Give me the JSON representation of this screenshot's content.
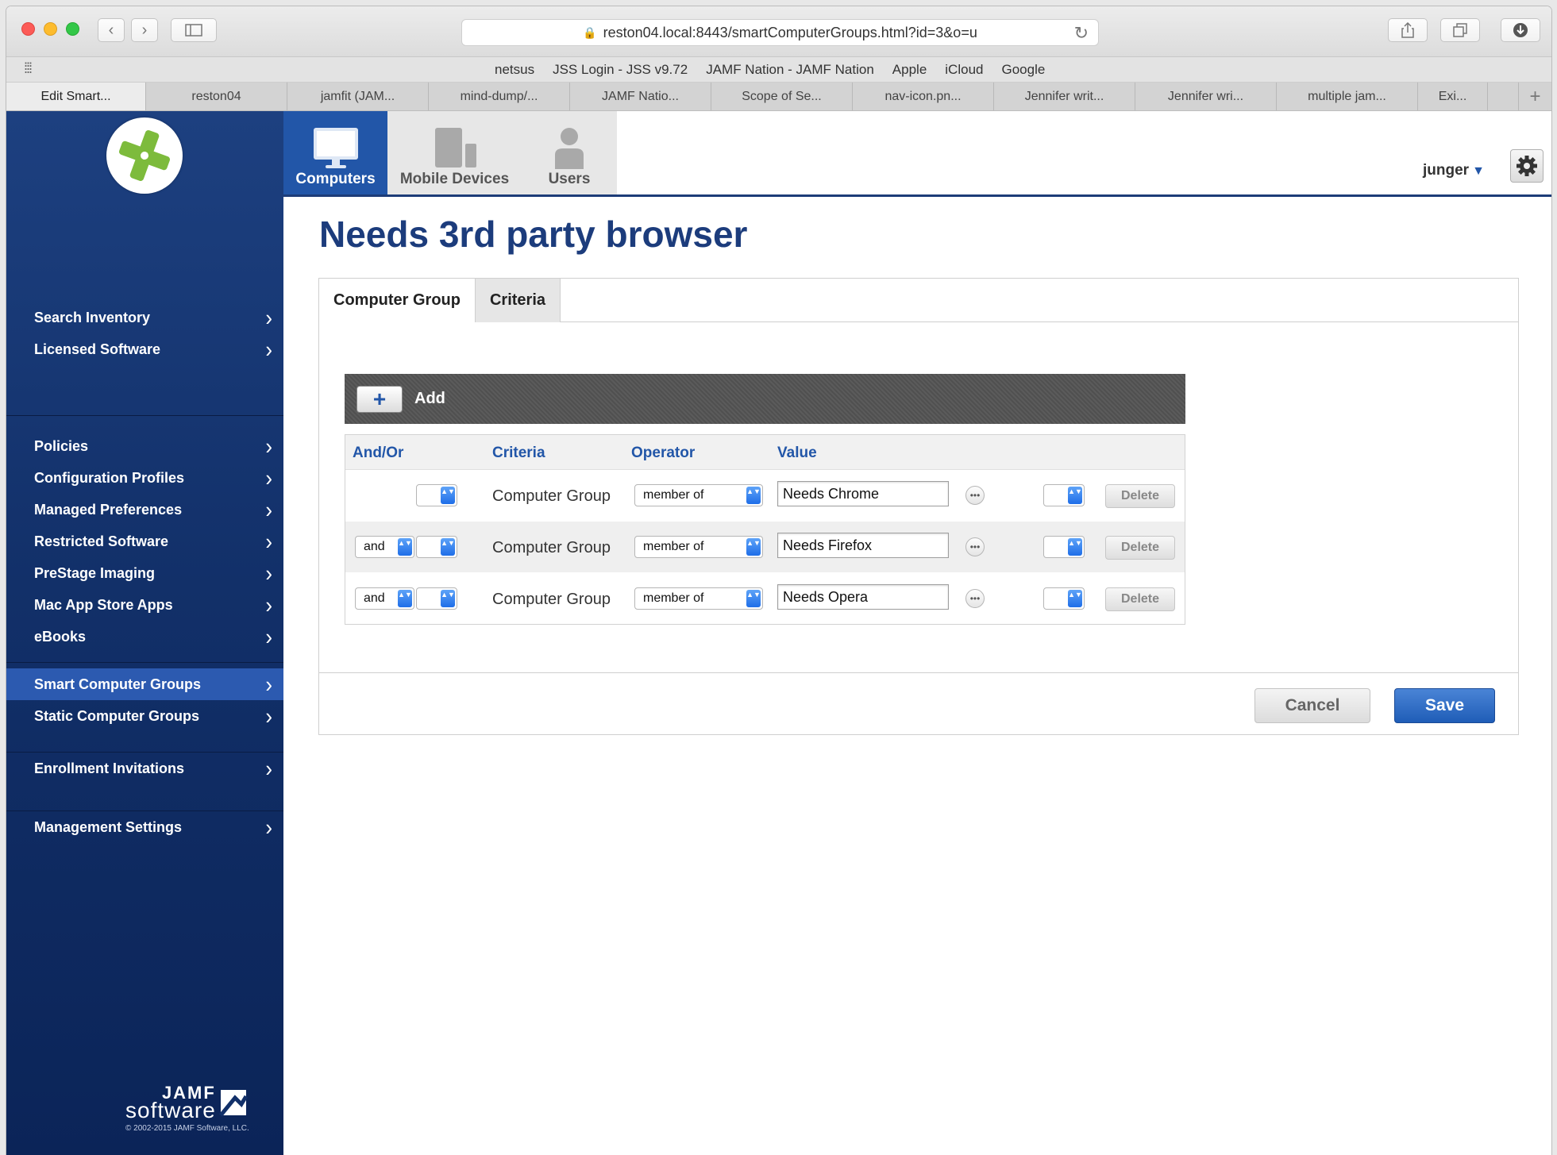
{
  "browser": {
    "url": "reston04.local:8443/smartComputerGroups.html?id=3&o=u",
    "favorites": [
      "netsus",
      "JSS Login - JSS v9.72",
      "JAMF Nation - JAMF Nation",
      "Apple",
      "iCloud",
      "Google"
    ],
    "tabs": [
      "Edit Smart...",
      "reston04",
      "jamfit (JAM...",
      "mind-dump/...",
      "JAMF Natio...",
      "Scope of Se...",
      "nav-icon.pn...",
      "Jennifer writ...",
      "Jennifer wri...",
      "multiple jam...",
      "Exi..."
    ],
    "icons": {
      "back": "chevron-left-icon",
      "forward": "chevron-right-icon",
      "sidebar": "sidebar-icon",
      "lock": "lock-icon",
      "reload": "reload-icon",
      "share": "share-icon",
      "tabs": "tabs-icon",
      "download": "download-icon"
    }
  },
  "sidebar": {
    "groups": [
      [
        "Search Inventory",
        "Licensed Software"
      ],
      [
        "Policies",
        "Configuration Profiles",
        "Managed Preferences",
        "Restricted Software",
        "PreStage Imaging",
        "Mac App Store Apps",
        "eBooks"
      ],
      [
        "Smart Computer Groups",
        "Static Computer Groups"
      ],
      [
        "Enrollment Invitations"
      ],
      [
        "Management Settings"
      ]
    ],
    "selected": "Smart Computer Groups",
    "footer": {
      "brand_top": "JAMF",
      "brand_bottom": "software",
      "copyright": "© 2002-2015 JAMF Software, LLC."
    }
  },
  "topnav": {
    "categories": [
      "Computers",
      "Mobile Devices",
      "Users"
    ],
    "active": "Computers",
    "user": "junger"
  },
  "page": {
    "title": "Needs 3rd party browser",
    "tabs": [
      "Computer Group",
      "Criteria"
    ],
    "active_tab": "Computer Group",
    "add_label": "Add",
    "columns": [
      "And/Or",
      "Criteria",
      "Operator",
      "Value"
    ],
    "rows": [
      {
        "andor": "",
        "criteria": "Computer Group",
        "operator": "member of",
        "value": "Needs Chrome",
        "delete": "Delete"
      },
      {
        "andor": "and",
        "criteria": "Computer Group",
        "operator": "member of",
        "value": "Needs Firefox",
        "delete": "Delete"
      },
      {
        "andor": "and",
        "criteria": "Computer Group",
        "operator": "member of",
        "value": "Needs Opera",
        "delete": "Delete"
      }
    ],
    "cancel_label": "Cancel",
    "save_label": "Save"
  },
  "colors": {
    "accent": "#2256a8",
    "title": "#1c3c7c",
    "sidebar": "#123069",
    "logo_green": "#7dbb3c"
  }
}
